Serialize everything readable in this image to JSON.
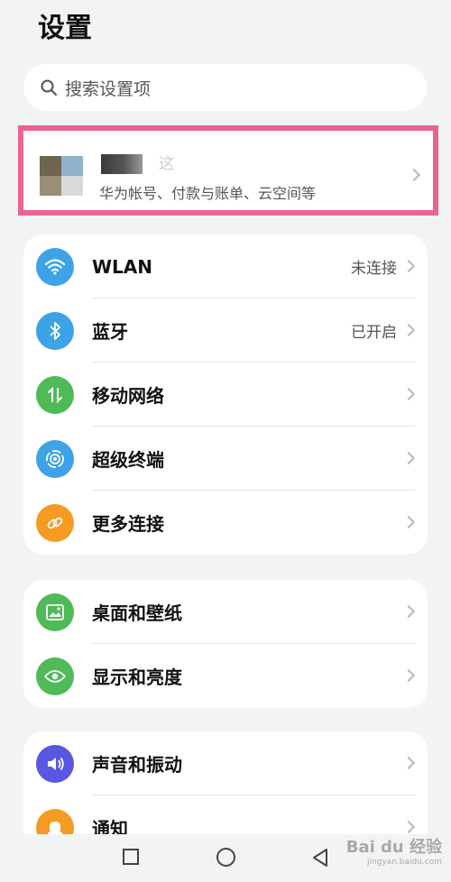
{
  "page": {
    "title": "设置"
  },
  "search": {
    "placeholder": "搜索设置项"
  },
  "account": {
    "name_partial": "这",
    "subtitle": "华为帐号、付款与账单、云空间等",
    "highlight_color": "#e9658d"
  },
  "group1": [
    {
      "label": "WLAN",
      "value": "未连接",
      "icon": "wifi-icon",
      "color": "#3ea3e6"
    },
    {
      "label": "蓝牙",
      "value": "已开启",
      "icon": "bluetooth-icon",
      "color": "#3ea3e6"
    },
    {
      "label": "移动网络",
      "value": "",
      "icon": "mobile-data-icon",
      "color": "#4fba57"
    },
    {
      "label": "超级终端",
      "value": "",
      "icon": "super-device-icon",
      "color": "#3ea3e6"
    },
    {
      "label": "更多连接",
      "value": "",
      "icon": "link-icon",
      "color": "#f59b23"
    }
  ],
  "group2": [
    {
      "label": "桌面和壁纸",
      "value": "",
      "icon": "wallpaper-icon",
      "color": "#4fba57"
    },
    {
      "label": "显示和亮度",
      "value": "",
      "icon": "eye-icon",
      "color": "#4fba57"
    }
  ],
  "group3": [
    {
      "label": "声音和振动",
      "value": "",
      "icon": "volume-icon",
      "color": "#5a57e0"
    },
    {
      "label": "通知",
      "value": "",
      "icon": "bell-icon",
      "color": "#f59b23"
    }
  ],
  "watermark": {
    "text": "Bai du 经验",
    "sub": "jingyan.baidu.com"
  }
}
